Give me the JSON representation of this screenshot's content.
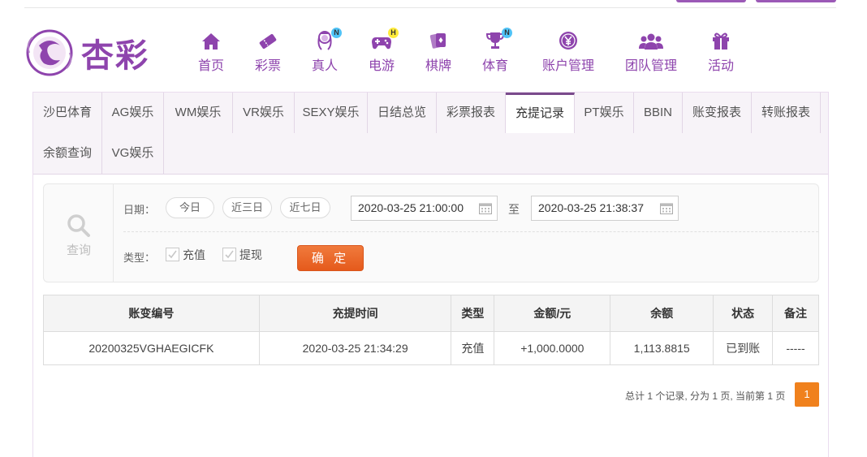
{
  "brand": {
    "name": "杏彩",
    "color": "#8e44ad"
  },
  "nav": [
    {
      "label": "首页",
      "icon": "home-icon",
      "badge": ""
    },
    {
      "label": "彩票",
      "icon": "ticket-icon",
      "badge": ""
    },
    {
      "label": "真人",
      "icon": "live-dealer-icon",
      "badge": "N"
    },
    {
      "label": "电游",
      "icon": "gamepad-icon",
      "badge": "H"
    },
    {
      "label": "棋牌",
      "icon": "cards-icon",
      "badge": ""
    },
    {
      "label": "体育",
      "icon": "trophy-icon",
      "badge": "N"
    },
    {
      "label": "账户管理",
      "icon": "yen-coin-icon",
      "badge": ""
    },
    {
      "label": "团队管理",
      "icon": "team-icon",
      "badge": ""
    },
    {
      "label": "活动",
      "icon": "gift-icon",
      "badge": ""
    }
  ],
  "tabs": [
    {
      "label": "沙巴体育"
    },
    {
      "label": "AG娱乐"
    },
    {
      "label": "WM娱乐"
    },
    {
      "label": "VR娱乐"
    },
    {
      "label": "SEXY娱乐"
    },
    {
      "label": "日结总览"
    },
    {
      "label": "彩票报表"
    },
    {
      "label": "充提记录",
      "active": true
    },
    {
      "label": "PT娱乐"
    },
    {
      "label": "BBIN"
    },
    {
      "label": "账变报表"
    },
    {
      "label": "转账报表"
    },
    {
      "label": "余额查询"
    },
    {
      "label": "VG娱乐"
    }
  ],
  "query": {
    "side_label": "查询",
    "date_label": "日期：",
    "quick": [
      "今日",
      "近三日",
      "近七日"
    ],
    "start": "2020-03-25 21:00:00",
    "to": "至",
    "end": "2020-03-25 21:38:37",
    "type_label": "类型：",
    "types": [
      "充值",
      "提现"
    ],
    "confirm": "确 定"
  },
  "table": {
    "headers": [
      "账变编号",
      "充提时间",
      "类型",
      "金额/元",
      "余额",
      "状态",
      "备注"
    ],
    "rows": [
      [
        "20200325VGHAEGICFK",
        "2020-03-25 21:34:29",
        "充值",
        "+1,000.0000",
        "1,113.8815",
        "已到账",
        "-----"
      ]
    ]
  },
  "pagination": {
    "summary": "总计 1 个记录, 分为 1 页, 当前第 1 页",
    "current": "1"
  }
}
